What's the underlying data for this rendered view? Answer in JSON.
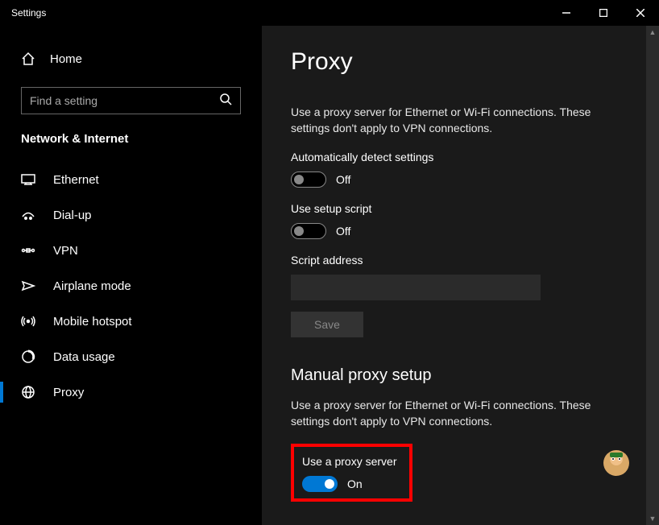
{
  "window": {
    "title": "Settings"
  },
  "sidebar": {
    "home_label": "Home",
    "search_placeholder": "Find a setting",
    "category": "Network & Internet",
    "items": [
      {
        "label": "Ethernet"
      },
      {
        "label": "Dial-up"
      },
      {
        "label": "VPN"
      },
      {
        "label": "Airplane mode"
      },
      {
        "label": "Mobile hotspot"
      },
      {
        "label": "Data usage"
      },
      {
        "label": "Proxy"
      }
    ]
  },
  "content": {
    "page_title": "Proxy",
    "desc1": "Use a proxy server for Ethernet or Wi-Fi connections. These settings don't apply to VPN connections.",
    "auto_detect_label": "Automatically detect settings",
    "auto_detect_state": "Off",
    "setup_script_label": "Use setup script",
    "setup_script_state": "Off",
    "script_address_label": "Script address",
    "save_label": "Save",
    "manual_title": "Manual proxy setup",
    "desc2": "Use a proxy server for Ethernet or Wi-Fi connections. These settings don't apply to VPN connections.",
    "use_proxy_label": "Use a proxy server",
    "use_proxy_state": "On"
  }
}
